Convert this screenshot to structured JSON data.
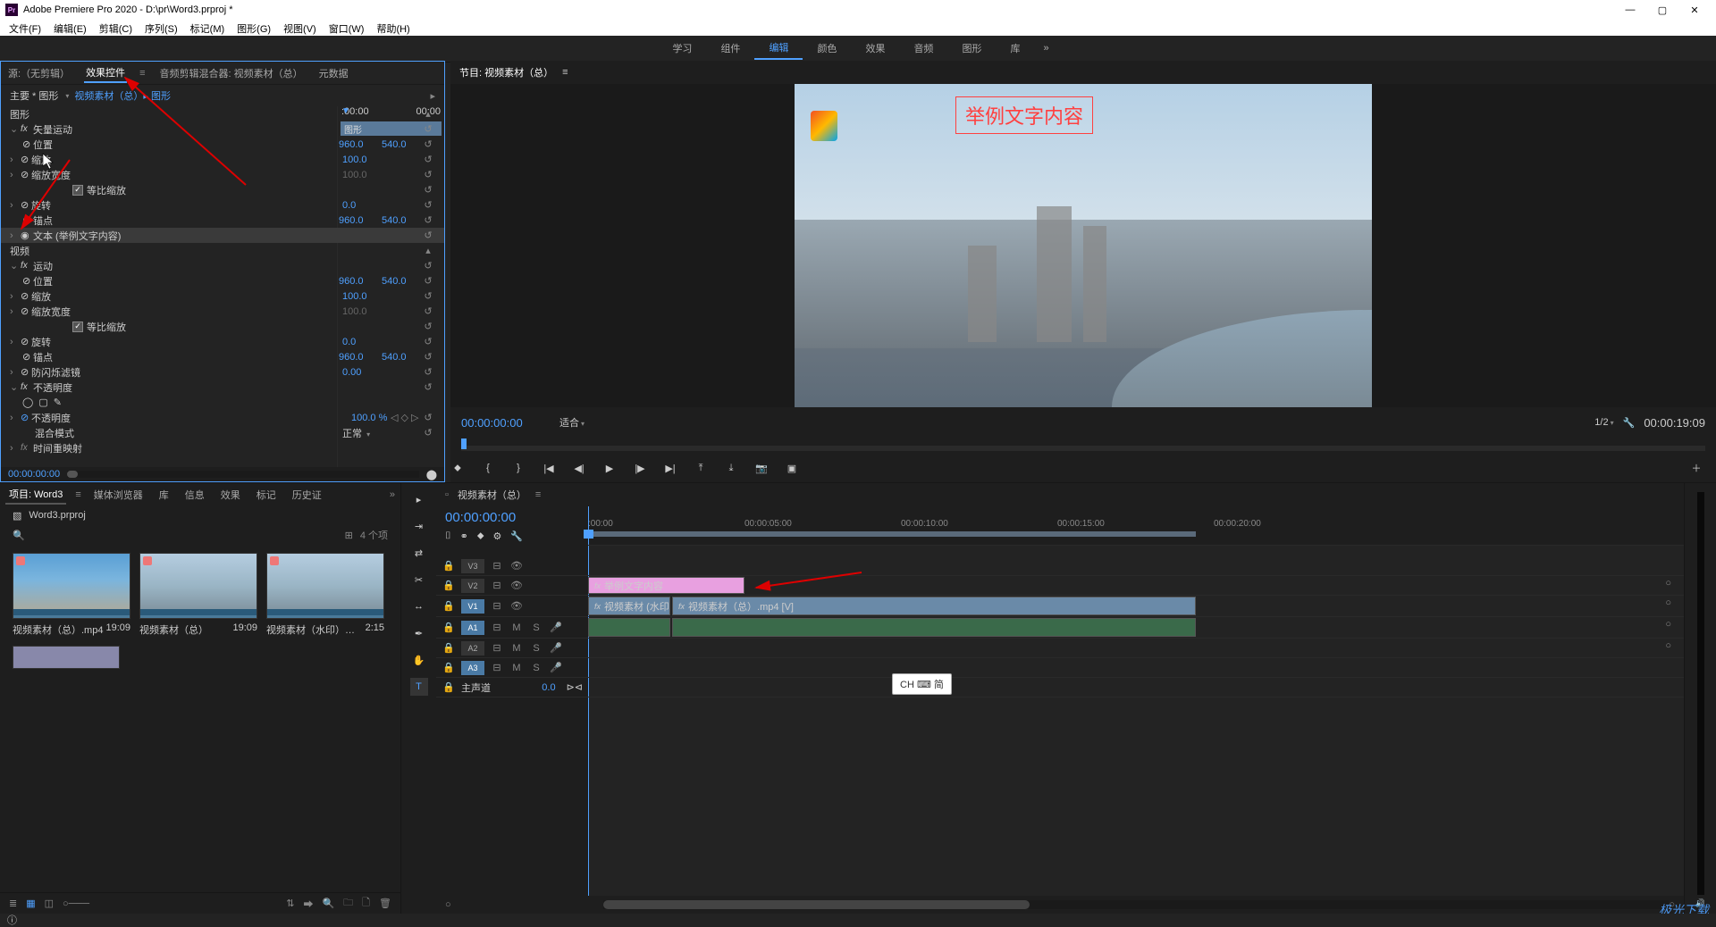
{
  "app": {
    "title": "Adobe Premiere Pro 2020 - D:\\pr\\Word3.prproj *"
  },
  "menus": [
    "文件(F)",
    "编辑(E)",
    "剪辑(C)",
    "序列(S)",
    "标记(M)",
    "图形(G)",
    "视图(V)",
    "窗口(W)",
    "帮助(H)"
  ],
  "workspaces": {
    "items": [
      "学习",
      "组件",
      "编辑",
      "颜色",
      "效果",
      "音频",
      "图形",
      "库"
    ],
    "active": "编辑",
    "more": "»"
  },
  "src_tabs": {
    "items": [
      "源:（无剪辑）",
      "效果控件",
      "音频剪辑混合器: 视频素材（总）",
      "元数据"
    ],
    "active": "效果控件"
  },
  "ec": {
    "path_pre": "主要 * 图形",
    "path_link": "视频素材（总）▸ 图形",
    "tl_start": ":00:00",
    "tl_end": "00:00",
    "tl_clip": "图形",
    "graphics_hdr": "图形",
    "vector_motion": "矢量运动",
    "position": "位置",
    "pos_x": "960.0",
    "pos_y": "540.0",
    "scale": "缩放",
    "scale_v": "100.0",
    "scale_w": "缩放宽度",
    "scale_w_v": "100.0",
    "uniform": "等比缩放",
    "rotation": "旋转",
    "rotation_v": "0.0",
    "anchor": "锚点",
    "anchor_x": "960.0",
    "anchor_y": "540.0",
    "text_layer": "文本 (举例文字内容)",
    "video_hdr": "视频",
    "motion": "运动",
    "anti_flicker": "防闪烁滤镜",
    "anti_flicker_v": "0.00",
    "opacity": "不透明度",
    "opacity_v": "100.0 %",
    "blend": "混合模式",
    "blend_v": "正常",
    "time_remapping": "时间重映射",
    "bottom_tc": "00:00:00:00"
  },
  "program": {
    "tab": "节目: 视频素材（总）",
    "overlay_text": "举例文字内容",
    "tc_l": "00:00:00:00",
    "fit": "适合",
    "zoom": "1/2",
    "tc_r": "00:00:19:09"
  },
  "project": {
    "tabs": [
      "项目: Word3",
      "媒体浏览器",
      "库",
      "信息",
      "效果",
      "标记",
      "历史证"
    ],
    "active": "项目: Word3",
    "name": "Word3.prproj",
    "count": "4 个项",
    "items": [
      {
        "name": "视频素材（总）.mp4",
        "dur": "19:09",
        "cls": "t1"
      },
      {
        "name": "视频素材（总）",
        "dur": "19:09",
        "cls": "t2"
      },
      {
        "name": "视频素材（水印）…",
        "dur": "2:15",
        "cls": "t3"
      }
    ]
  },
  "timeline": {
    "tab": "视频素材（总）",
    "tc": "00:00:00:00",
    "ticks": [
      ":00:00",
      "00:00:05:00",
      "00:00:10:00",
      "00:00:15:00",
      "00:00:20:00"
    ],
    "v_tracks": [
      "V3",
      "V2",
      "V1"
    ],
    "a_tracks": [
      "A1",
      "A2",
      "A3"
    ],
    "master": "主声道",
    "master_v": "0.0",
    "clip_text": "举例文字内容",
    "clip_v1a": "视频素材 (水印",
    "clip_v1b": "视频素材（总）.mp4 [V]"
  },
  "ime": "CH ⌨ 简",
  "watermark": "极光下载"
}
